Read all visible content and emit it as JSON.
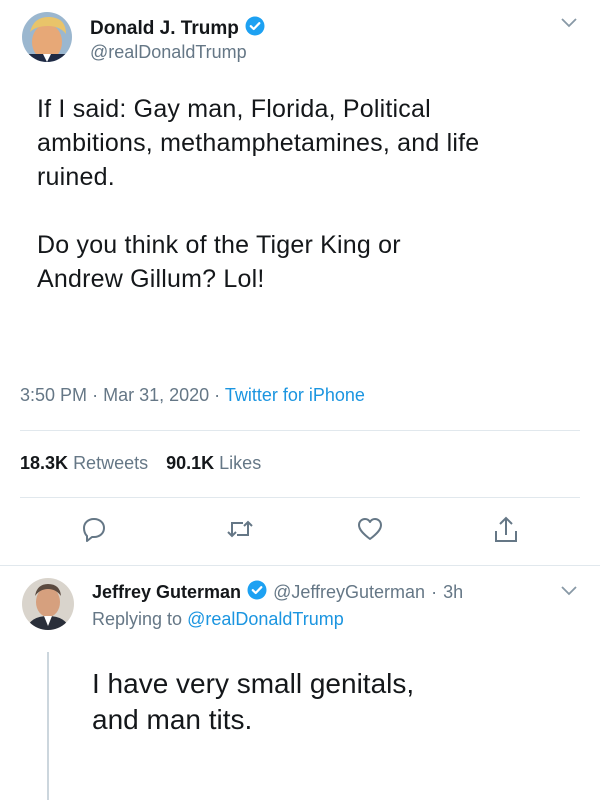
{
  "tweet": {
    "author_name": "Donald J. Trump",
    "author_handle": "@realDonaldTrump",
    "text_lines": [
      "If I said: Gay man, Florida, Political",
      "ambitions, methamphetamines, and life",
      "ruined.",
      "Do you think of the Tiger King or",
      "Andrew Gillum? Lol!"
    ],
    "time": "3:50 PM",
    "date": "Mar 31, 2020",
    "separator": "·",
    "source": "Twitter for iPhone",
    "retweets_count": "18.3K",
    "retweets_label": "Retweets",
    "likes_count": "90.1K",
    "likes_label": "Likes"
  },
  "reply": {
    "author_name": "Jeffrey Guterman",
    "author_handle": "@JeffreyGuterman",
    "age": "3h",
    "replying_prefix": "Replying to",
    "replying_to": "@realDonaldTrump",
    "text_lines": [
      "I have very small genitals,",
      "and man tits."
    ]
  },
  "icons": {
    "verified": "verified-badge-icon",
    "more": "chevron-down-icon",
    "reply": "reply-icon",
    "retweet": "retweet-icon",
    "like": "heart-icon",
    "share": "share-icon"
  },
  "colors": {
    "link": "#1b95e0",
    "verified": "#1da1f2",
    "secondary_text": "#657786",
    "divider": "#e1e8ed"
  }
}
